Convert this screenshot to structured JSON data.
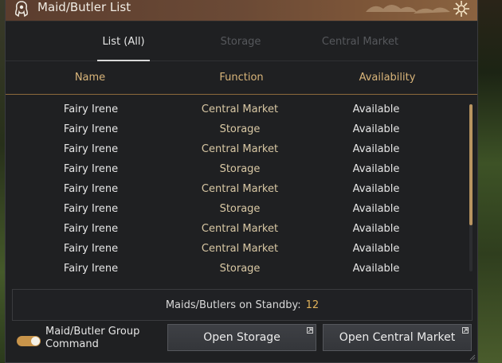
{
  "window": {
    "title": "Maid/Butler List"
  },
  "tabs": [
    {
      "label": "List (All)"
    },
    {
      "label": "Storage"
    },
    {
      "label": "Central Market"
    }
  ],
  "columns": {
    "name": "Name",
    "function": "Function",
    "availability": "Availability"
  },
  "rows": [
    {
      "name": "Fairy Irene",
      "function": "Central Market",
      "availability": "Available"
    },
    {
      "name": "Fairy Irene",
      "function": "Storage",
      "availability": "Available"
    },
    {
      "name": "Fairy Irene",
      "function": "Central Market",
      "availability": "Available"
    },
    {
      "name": "Fairy Irene",
      "function": "Storage",
      "availability": "Available"
    },
    {
      "name": "Fairy Irene",
      "function": "Central Market",
      "availability": "Available"
    },
    {
      "name": "Fairy Irene",
      "function": "Storage",
      "availability": "Available"
    },
    {
      "name": "Fairy Irene",
      "function": "Central Market",
      "availability": "Available"
    },
    {
      "name": "Fairy Irene",
      "function": "Central Market",
      "availability": "Available"
    },
    {
      "name": "Fairy Irene",
      "function": "Storage",
      "availability": "Available"
    }
  ],
  "standby": {
    "label": "Maids/Butlers on Standby:",
    "count": "12"
  },
  "footer": {
    "group_toggle_label": "Maid/Butler Group Command",
    "open_storage": "Open Storage",
    "open_central_market": "Open Central Market"
  },
  "colors": {
    "accent": "#d9b57a",
    "toggle": "#c8944a",
    "count": "#e0b25a"
  }
}
